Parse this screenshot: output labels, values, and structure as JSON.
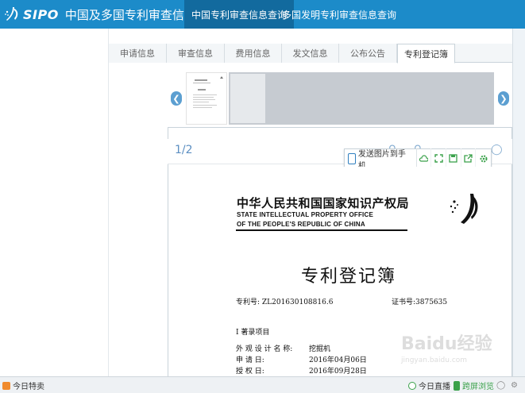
{
  "header": {
    "logo_text": "SIPO",
    "site_title": "中国及多国专利审查信息查询",
    "nav_tabs": [
      {
        "label": "中国专利审查信息查询",
        "active": true
      },
      {
        "label": "多国发明专利审查信息查询",
        "active": false
      }
    ],
    "brand_color": "#1c8bc9",
    "active_color": "#126a9e"
  },
  "sub_tabs": [
    {
      "label": "申请信息",
      "active": false
    },
    {
      "label": "审查信息",
      "active": false
    },
    {
      "label": "费用信息",
      "active": false
    },
    {
      "label": "发文信息",
      "active": false
    },
    {
      "label": "公布公告",
      "active": false
    },
    {
      "label": "专利登记簿",
      "active": true
    }
  ],
  "viewer": {
    "page_indicator": "1/2",
    "prev_icon": "chevron-left-icon",
    "next_icon": "chevron-right-icon",
    "toolbar": {
      "send_label": "发送图片到手机",
      "icons": [
        "cloud-icon",
        "fullscreen-icon",
        "save-icon",
        "share-icon",
        "settings-icon"
      ]
    }
  },
  "document": {
    "org_cn": "中华人民共和国国家知识产权局",
    "org_en_1": "STATE INTELLECTUAL PROPERTY OFFICE",
    "org_en_2": "OF THE PEOPLE'S REPUBLIC OF CHINA",
    "title": "专利登记簿",
    "patent_no": "专利号: ZL201630108816.6",
    "cert_no": "证书号:3875635",
    "section": "I 著录项目",
    "rows": [
      {
        "label": "外 观 设 计 名 称:",
        "value": "挖掘机"
      },
      {
        "label": "申           请     日:",
        "value": "2016年04月06日"
      },
      {
        "label": "授           权     日:",
        "value": "2016年09月28日"
      }
    ]
  },
  "status_bar": {
    "left_label": "今日特卖",
    "live_label": "今日直播",
    "cross_screen_label": "跨屏浏览"
  },
  "watermark": {
    "text": "Baidu经验",
    "sub": "jingyan.baidu.com"
  }
}
